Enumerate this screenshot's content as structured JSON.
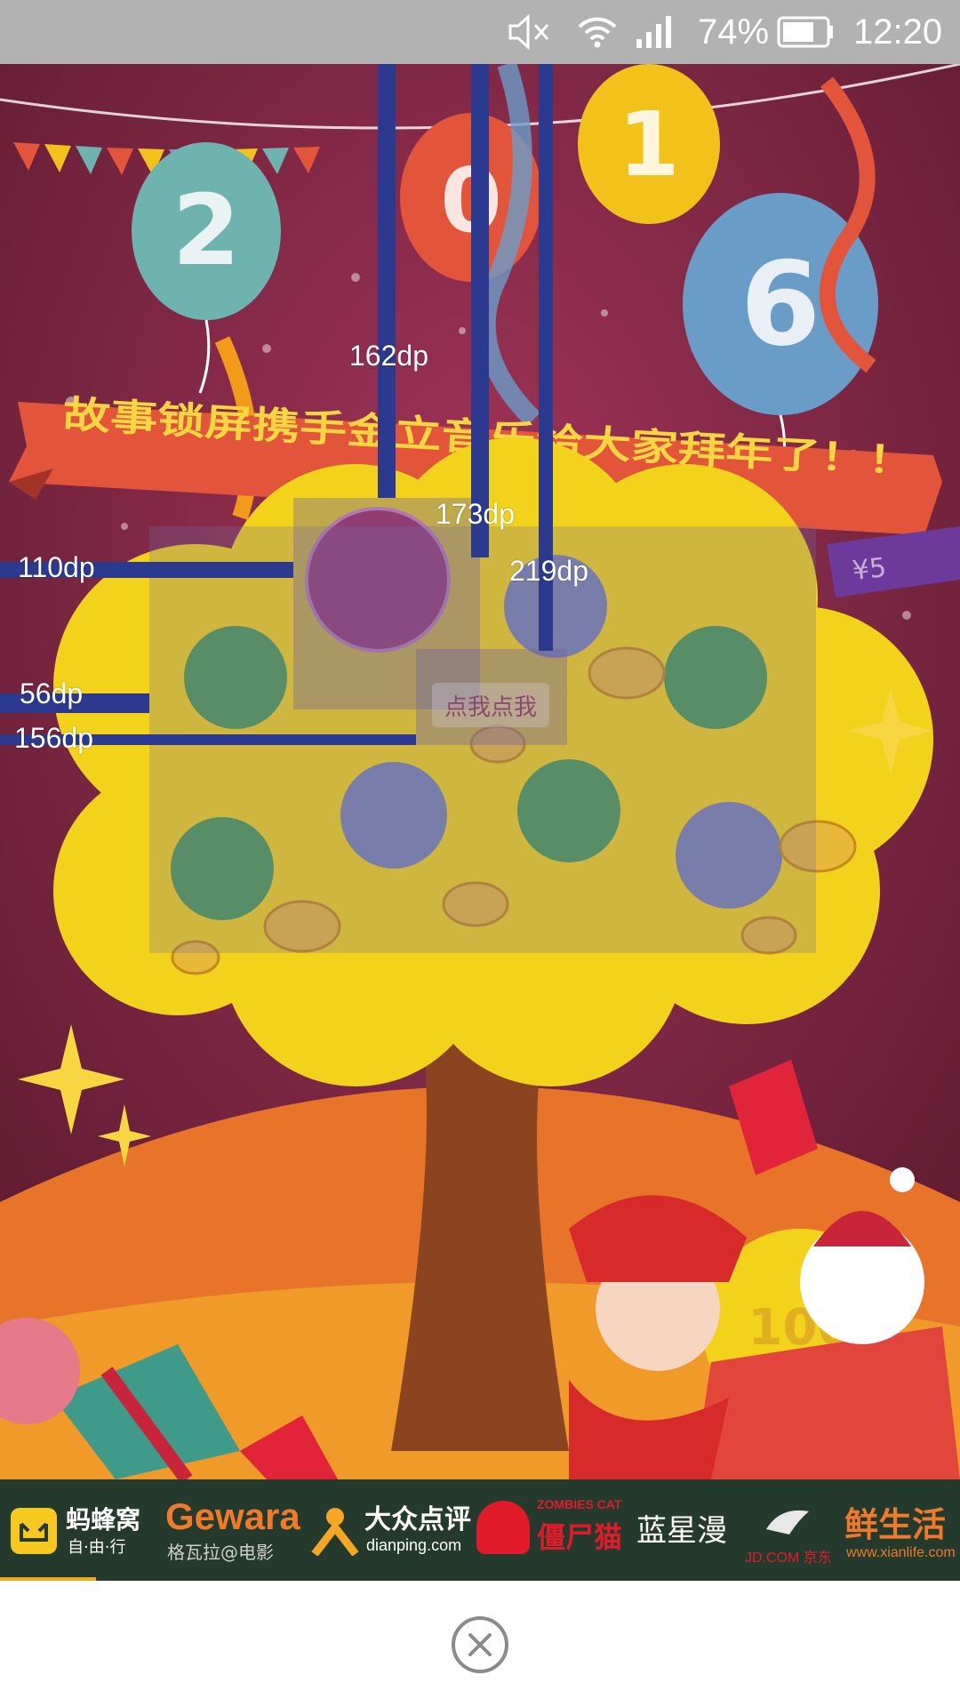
{
  "status_bar": {
    "battery_percent": "74%",
    "time": "12:20",
    "battery_level": 0.74,
    "icons": [
      "volume-muted-icon",
      "wifi-icon",
      "signal-icon",
      "battery-icon"
    ]
  },
  "poster": {
    "banner_text": "故事锁屏携手金立音乐给大家拜年了！！",
    "balloon_digits": [
      "2",
      "0",
      "1",
      "6"
    ],
    "tree_button_label": "点我点我",
    "coin_text": "100",
    "ribbon_text": "¥5",
    "colors": {
      "background": "#7a2740",
      "tree": "#f2d21a",
      "banner": "#e2553b",
      "overlay_bar": "#2b3a8f"
    }
  },
  "measurements": {
    "labels": [
      "162dp",
      "173dp",
      "219dp",
      "110dp",
      "56dp",
      "156dp"
    ]
  },
  "sponsors": {
    "mafengwo": {
      "name": "蚂蜂窝",
      "sub": "自·由·行"
    },
    "gewara": {
      "name": "Gewara",
      "sub": "格瓦拉@电影"
    },
    "dianping": {
      "name": "大众点评",
      "sub": "dianping.com"
    },
    "zombies_cat": {
      "name": "ZOMBIES CAT",
      "sub": "僵尸猫"
    },
    "lanxingman": {
      "name": "蓝星漫"
    },
    "jd": {
      "name": "JD.COM 京东"
    },
    "xianlife": {
      "name": "鲜生活",
      "sub": "www.xianlife.com"
    }
  },
  "close": {
    "icon": "close-icon"
  }
}
